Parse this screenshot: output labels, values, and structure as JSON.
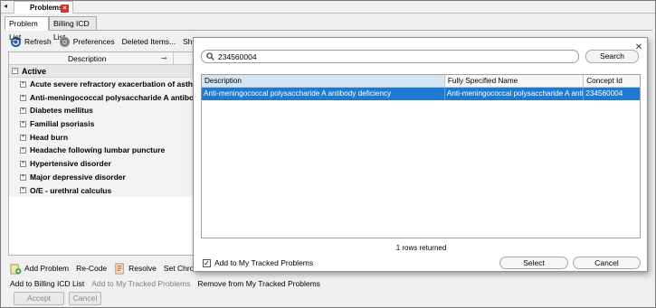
{
  "doc_tab": {
    "title": "Problems",
    "close": "×"
  },
  "tabs": [
    {
      "label": "Problem List"
    },
    {
      "label": "Billing ICD List"
    }
  ],
  "toolbar": {
    "refresh": "Refresh",
    "preferences": "Preferences",
    "deleted_items": "Deleted Items...",
    "show_all": "Show All Stat"
  },
  "grid": {
    "description_header": "Description",
    "group": "Active",
    "rows": [
      "Acute severe refractory exacerbation of asthma",
      "Anti-meningococcal polysaccharide A antibody",
      "Diabetes mellitus",
      "Familial psoriasis",
      "Head burn",
      "Headache following lumbar puncture",
      "Hypertensive disorder",
      "Major depressive disorder",
      "O/E - urethral calculus"
    ]
  },
  "bottom_toolbar": {
    "add_problem": "Add Problem",
    "re_code": "Re-Code",
    "resolve": "Resolve",
    "set_chronic": "Set Chronic"
  },
  "bottom_links": {
    "add_billing": "Add to Billing ICD List",
    "add_tracked": "Add to My Tracked Problems",
    "remove_tracked": "Remove from My Tracked Problems"
  },
  "bottom_buttons": {
    "accept": "Accept",
    "cancel": "Cancel"
  },
  "dialog": {
    "search_value": "234560004",
    "search_button": "Search",
    "columns": [
      "Description",
      "Fully Specified Name",
      "Concept Id"
    ],
    "results": [
      {
        "description": "Anti-meningococcal polysaccharide A antibody deficiency",
        "fully_specified_name": "Anti-meningococcal polysaccharide A antibody deficiency",
        "concept_id": "234560004"
      }
    ],
    "rows_returned": "1 rows returned",
    "add_to_tracked_label": "Add to My Tracked Problems",
    "add_to_tracked_checked": true,
    "select_button": "Select",
    "cancel_button": "Cancel"
  },
  "colors": {
    "selection": "#1e7bd1",
    "header_highlight": "#d6e5f4",
    "close_badge": "#d9312b"
  }
}
